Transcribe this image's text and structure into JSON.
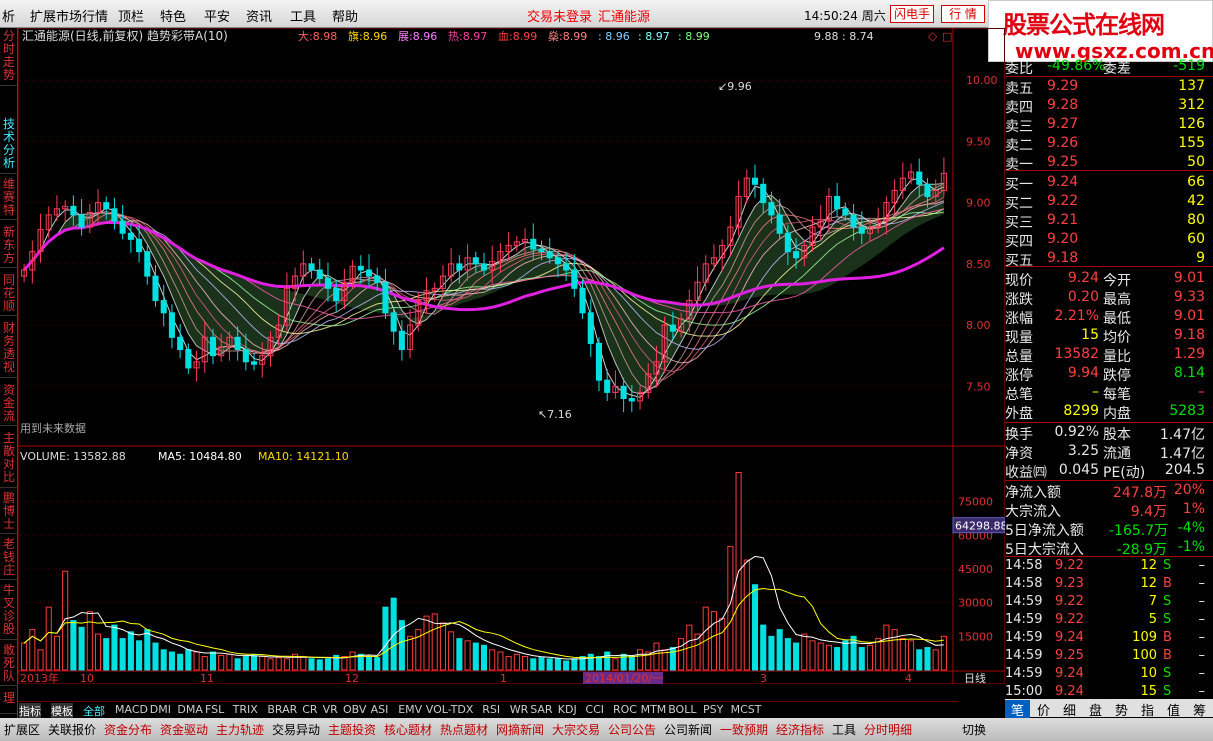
{
  "menubar": {
    "items": [
      "析",
      "扩展市场行情",
      "顶栏",
      "特色",
      "平安",
      "资讯",
      "工具",
      "帮助"
    ],
    "status_items": [
      "交易未登录",
      "汇通能源"
    ],
    "clock": "14:50:24 周六",
    "btn_flash": "闪电手",
    "btn_quote": "行 情"
  },
  "logo": {
    "line1": "股票公式在线网",
    "line2": "www.gsxz.com.cn"
  },
  "left_tabs": [
    "分时走势",
    "技术分析",
    "维赛特",
    "新东方",
    "同花顺",
    "财务透视",
    "资金流",
    "主散对比",
    "鹏博士",
    "老钱庄",
    "牛叉诊股",
    "敢死队",
    "理"
  ],
  "chart_data": [
    {
      "type": "candlestick",
      "title": "汇通能源(日线,前复权) 趋势彩带A(10)",
      "indicators": [
        {
          "name": "大",
          "value": "8.98"
        },
        {
          "name": "旗",
          "value": "8.96"
        },
        {
          "name": "展",
          "value": "8.96"
        },
        {
          "name": "热",
          "value": "8.97"
        },
        {
          "name": "血",
          "value": "8.99"
        },
        {
          "name": "燊",
          "value": "8.99"
        },
        {
          "name": "",
          "value": "8.96"
        },
        {
          "name": "",
          "value": "8.97"
        },
        {
          "name": "",
          "value": "8.99"
        }
      ],
      "range_label": "9.88 : 8.74",
      "y_ticks": [
        "10.00",
        "9.50",
        "9.00",
        "8.50",
        "8.00",
        "7.50"
      ],
      "ylim": [
        7.2,
        10.1
      ],
      "high_label": "9.96",
      "low_label": "7.16",
      "note": "用到未来数据",
      "closes": [
        8.45,
        8.6,
        8.78,
        8.9,
        8.95,
        8.97,
        8.9,
        8.8,
        8.92,
        9.0,
        8.95,
        8.85,
        8.75,
        8.7,
        8.6,
        8.4,
        8.2,
        8.1,
        7.9,
        7.8,
        7.65,
        7.7,
        7.9,
        7.75,
        7.82,
        7.9,
        7.8,
        7.7,
        7.68,
        7.75,
        7.9,
        8.0,
        8.3,
        8.4,
        8.5,
        8.45,
        8.38,
        8.3,
        8.2,
        8.35,
        8.48,
        8.45,
        8.4,
        8.35,
        8.1,
        7.95,
        7.8,
        8.0,
        8.2,
        8.28,
        8.3,
        8.4,
        8.5,
        8.45,
        8.55,
        8.5,
        8.45,
        8.52,
        8.6,
        8.65,
        8.68,
        8.7,
        8.62,
        8.6,
        8.55,
        8.5,
        8.45,
        8.3,
        8.1,
        7.85,
        7.55,
        7.45,
        7.5,
        7.4,
        7.38,
        7.45,
        7.6,
        7.7,
        8.0,
        7.95,
        8.05,
        8.2,
        8.35,
        8.5,
        8.55,
        8.65,
        8.8,
        9.05,
        9.2,
        9.15,
        9.0,
        8.9,
        8.75,
        8.6,
        8.55,
        8.65,
        8.8,
        8.85,
        9.05,
        8.95,
        8.9,
        8.8,
        8.75,
        8.8,
        8.85,
        9.0,
        9.1,
        9.2,
        9.25,
        9.15,
        9.05,
        9.1,
        9.24
      ]
    },
    {
      "type": "bar",
      "title": "VOLUME",
      "header": [
        {
          "name": "VOLUME",
          "value": "13582.88"
        },
        {
          "name": "MA5",
          "value": "10484.80"
        },
        {
          "name": "MA10",
          "value": "14121.10"
        }
      ],
      "y_ticks": [
        "75000",
        "60000",
        "45000",
        "30000",
        "15000"
      ],
      "ylim": [
        0,
        90000
      ],
      "current_label": "64298.88",
      "values": [
        12000,
        18000,
        9000,
        28000,
        15000,
        44000,
        22000,
        19000,
        26000,
        16000,
        14000,
        20000,
        14000,
        17000,
        13000,
        18000,
        12000,
        9000,
        8000,
        7000,
        9000,
        8000,
        6000,
        8000,
        6500,
        7000,
        5000,
        6000,
        7000,
        6000,
        5000,
        5500,
        5000,
        7000,
        6000,
        5000,
        4500,
        5000,
        6500,
        6000,
        8000,
        7000,
        6000,
        5500,
        28000,
        32000,
        22000,
        15000,
        18000,
        24000,
        25000,
        21000,
        17000,
        14000,
        13000,
        12000,
        11000,
        9000,
        8000,
        6000,
        7000,
        6000,
        5000,
        5500,
        5000,
        5000,
        4000,
        5000,
        6000,
        7000,
        6000,
        8000,
        5000,
        7000,
        6000,
        9000,
        8000,
        12000,
        9000,
        10000,
        14000,
        20000,
        16000,
        28000,
        26000,
        23000,
        55000,
        88000,
        49000,
        38000,
        20000,
        15000,
        18000,
        14000,
        12000,
        16000,
        13000,
        12000,
        11000,
        10000,
        13000,
        15000,
        10000,
        11000,
        14000,
        20000,
        18000,
        14000,
        13000,
        9000,
        10000,
        9000,
        15000
      ]
    },
    {
      "type": "table",
      "x_axis": [
        "2013年",
        "10",
        "11",
        "12",
        "1",
        "2014/01/20/一",
        "3",
        "4"
      ],
      "period": "日线"
    }
  ],
  "right_panel": {
    "weibi": {
      "label": "委比",
      "value": "-49.86%",
      "label2": "委差",
      "value2": "-519"
    },
    "sell": [
      {
        "l": "卖五",
        "p": "9.29",
        "v": "137"
      },
      {
        "l": "卖四",
        "p": "9.28",
        "v": "312"
      },
      {
        "l": "卖三",
        "p": "9.27",
        "v": "126"
      },
      {
        "l": "卖二",
        "p": "9.26",
        "v": "155"
      },
      {
        "l": "卖一",
        "p": "9.25",
        "v": "50"
      }
    ],
    "buy": [
      {
        "l": "买一",
        "p": "9.24",
        "v": "66"
      },
      {
        "l": "买二",
        "p": "9.22",
        "v": "42"
      },
      {
        "l": "买三",
        "p": "9.21",
        "v": "80"
      },
      {
        "l": "买四",
        "p": "9.20",
        "v": "60"
      },
      {
        "l": "买五",
        "p": "9.18",
        "v": "9"
      }
    ],
    "quote": [
      {
        "a": "现价",
        "b": "9.24",
        "c": "今开",
        "d": "9.01"
      },
      {
        "a": "涨跌",
        "b": "0.20",
        "c": "最高",
        "d": "9.33"
      },
      {
        "a": "涨幅",
        "b": "2.21%",
        "c": "最低",
        "d": "9.01"
      },
      {
        "a": "现量",
        "b": "15",
        "c": "均价",
        "d": "9.18"
      },
      {
        "a": "总量",
        "b": "13582",
        "c": "量比",
        "d": "1.29"
      },
      {
        "a": "涨停",
        "b": "9.94",
        "c": "跌停",
        "d": "8.14"
      },
      {
        "a": "总笔",
        "b": "–",
        "c": "每笔",
        "d": "–"
      },
      {
        "a": "外盘",
        "b": "8299",
        "c": "内盘",
        "d": "5283"
      }
    ],
    "fin": [
      {
        "a": "换手",
        "b": "0.92%",
        "c": "股本",
        "d": "1.47亿"
      },
      {
        "a": "净资",
        "b": "3.25",
        "c": "流通",
        "d": "1.47亿"
      },
      {
        "a": "收益㈣",
        "b": "0.045",
        "c": "PE(动)",
        "d": "204.5"
      }
    ],
    "flow": [
      {
        "a": "净流入额",
        "b": "247.8万",
        "c": "20%"
      },
      {
        "a": "大宗流入",
        "b": "9.4万",
        "c": "1%"
      },
      {
        "a": "5日净流入额",
        "b": "-165.7万",
        "c": "-4%"
      },
      {
        "a": "5日大宗流入",
        "b": "-28.9万",
        "c": "-1%"
      }
    ],
    "ticks": [
      {
        "t": "14:58",
        "p": "9.22",
        "v": "12",
        "s": "S"
      },
      {
        "t": "14:58",
        "p": "9.23",
        "v": "12",
        "s": "B"
      },
      {
        "t": "14:59",
        "p": "9.22",
        "v": "7",
        "s": "S"
      },
      {
        "t": "14:59",
        "p": "9.22",
        "v": "5",
        "s": "S"
      },
      {
        "t": "14:59",
        "p": "9.24",
        "v": "109",
        "s": "B"
      },
      {
        "t": "14:59",
        "p": "9.25",
        "v": "100",
        "s": "B"
      },
      {
        "t": "14:59",
        "p": "9.24",
        "v": "10",
        "s": "S"
      },
      {
        "t": "15:00",
        "p": "9.24",
        "v": "15",
        "s": "S"
      }
    ],
    "tabs": [
      "笔",
      "价",
      "细",
      "盘",
      "势",
      "指",
      "值",
      "筹"
    ]
  },
  "indicator_tabs": [
    "指标",
    "模板",
    "全部",
    "MACD",
    "DMI",
    "DMA",
    "FSL",
    "TRIX",
    "BRAR",
    "CR",
    "VR",
    "OBV",
    "ASI",
    "EMV",
    "VOL-TDX",
    "RSI",
    "WR",
    "SAR",
    "KDJ",
    "CCI",
    "ROC",
    "MTM",
    "BOLL",
    "PSY",
    "MCST"
  ],
  "bottom_tabs": [
    "扩展区",
    "关联报价",
    "资金分布",
    "资金驱动",
    "主力轨迹",
    "交易异动",
    "主题投资",
    "核心题材",
    "热点题材",
    "网摘新闻",
    "大宗交易",
    "公司公告",
    "公司新闻",
    "一致预期",
    "经济指标",
    "工具",
    "分时明细",
    "切换"
  ],
  "colors": {
    "up": "#ff3b5c",
    "down": "#00e0e0",
    "up_vol": "#ff3b3b",
    "green": "#00d000",
    "magenta": "#e020e0",
    "yellow": "#ffff00",
    "grid": "#550000"
  }
}
